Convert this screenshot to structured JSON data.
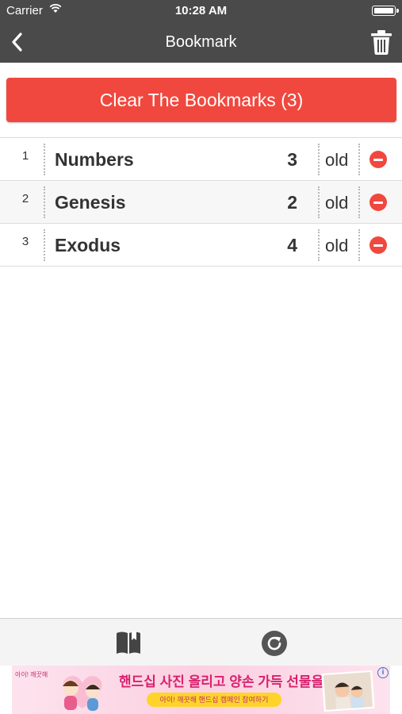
{
  "status_bar": {
    "carrier": "Carrier",
    "time": "10:28 AM"
  },
  "nav": {
    "title": "Bookmark"
  },
  "clear_button": {
    "label": "Clear The Bookmarks (3)"
  },
  "bookmarks": [
    {
      "index": "1",
      "book": "Numbers",
      "chapter": "3",
      "testament": "old"
    },
    {
      "index": "2",
      "book": "Genesis",
      "chapter": "2",
      "testament": "old"
    },
    {
      "index": "3",
      "book": "Exodus",
      "chapter": "4",
      "testament": "old"
    }
  ],
  "ad": {
    "brand": "아이! 깨끗해",
    "headline": "핸드십 사진 올리고 양손 가득 선물을!",
    "sub": "아이! 깨끗해 핸드십 캠페인 참여하기"
  },
  "colors": {
    "bar": "#4a4a4a",
    "accent": "#f0483e",
    "row_alt": "#f7f7f7"
  },
  "icons": [
    "back-chevron-icon",
    "trash-icon",
    "remove-circle-icon",
    "book-icon",
    "refresh-icon",
    "info-icon",
    "wifi-icon",
    "battery-icon"
  ]
}
